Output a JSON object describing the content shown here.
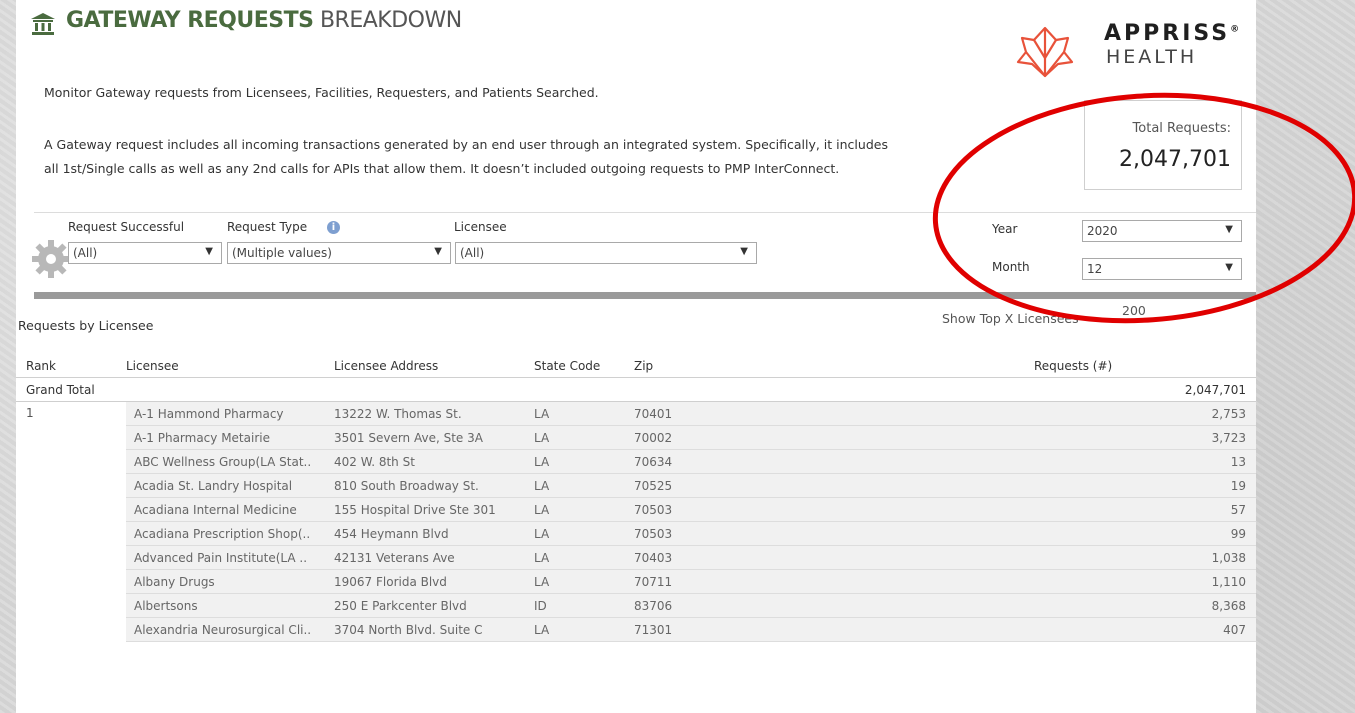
{
  "header": {
    "title_bold": "GATEWAY REQUESTS",
    "title_light": "BREAKDOWN",
    "description_1": "Monitor Gateway requests from Licensees, Facilities, Requesters, and Patients Searched.",
    "description_2": "A Gateway request includes all incoming transactions generated by an end user through an integrated system. Specifically, it includes",
    "description_3": "all 1st/Single calls as well as any 2nd calls for APIs that allow them. It doesn’t included outgoing requests to PMP InterConnect."
  },
  "logo": {
    "name": "APPRISS",
    "registered": "®",
    "sub": "HEALTH",
    "color": "#e8523a"
  },
  "total": {
    "label": "Total Requests:",
    "value": "2,047,701"
  },
  "filters": {
    "request_successful": {
      "label": "Request Successful",
      "value": "(All)"
    },
    "request_type": {
      "label": "Request Type",
      "value": "(Multiple values)"
    },
    "licensee": {
      "label": "Licensee",
      "value": "(All)"
    },
    "year": {
      "label": "Year",
      "value": "2020"
    },
    "month": {
      "label": "Month",
      "value": "12"
    }
  },
  "section": {
    "title": "Requests by Licensee",
    "show_top_label": "Show Top X Licensees",
    "show_top_value": "200"
  },
  "table": {
    "headers": [
      "Rank",
      "Licensee",
      "Licensee Address",
      "State Code",
      "Zip",
      "Requests (#)"
    ],
    "grand_total_label": "Grand Total",
    "grand_total_value": "2,047,701",
    "rank": "1",
    "rows": [
      {
        "licensee": "A-1 Hammond Pharmacy",
        "address": "13222 W. Thomas St.",
        "state": "LA",
        "zip": "70401",
        "requests": "2,753"
      },
      {
        "licensee": "A-1 Pharmacy Metairie",
        "address": "3501 Severn Ave, Ste 3A",
        "state": "LA",
        "zip": "70002",
        "requests": "3,723"
      },
      {
        "licensee": "ABC Wellness Group(LA Stat..",
        "address": "402 W. 8th St",
        "state": "LA",
        "zip": "70634",
        "requests": "13"
      },
      {
        "licensee": "Acadia St. Landry Hospital",
        "address": "810 South Broadway St.",
        "state": "LA",
        "zip": "70525",
        "requests": "19"
      },
      {
        "licensee": "Acadiana Internal Medicine",
        "address": "155 Hospital Drive Ste 301",
        "state": "LA",
        "zip": "70503",
        "requests": "57"
      },
      {
        "licensee": "Acadiana Prescription Shop(..",
        "address": "454 Heymann Blvd",
        "state": "LA",
        "zip": "70503",
        "requests": "99"
      },
      {
        "licensee": "Advanced Pain Institute(LA ..",
        "address": "42131 Veterans Ave",
        "state": "LA",
        "zip": "70403",
        "requests": "1,038"
      },
      {
        "licensee": "Albany Drugs",
        "address": "19067 Florida Blvd",
        "state": "LA",
        "zip": "70711",
        "requests": "1,110"
      },
      {
        "licensee": "Albertsons",
        "address": "250 E Parkcenter Blvd",
        "state": "ID",
        "zip": "83706",
        "requests": "8,368"
      },
      {
        "licensee": "Alexandria Neurosurgical Cli..",
        "address": "3704 North Blvd.  Suite C",
        "state": "LA",
        "zip": "71301",
        "requests": "407"
      }
    ]
  },
  "annotation_color": "#e00000"
}
